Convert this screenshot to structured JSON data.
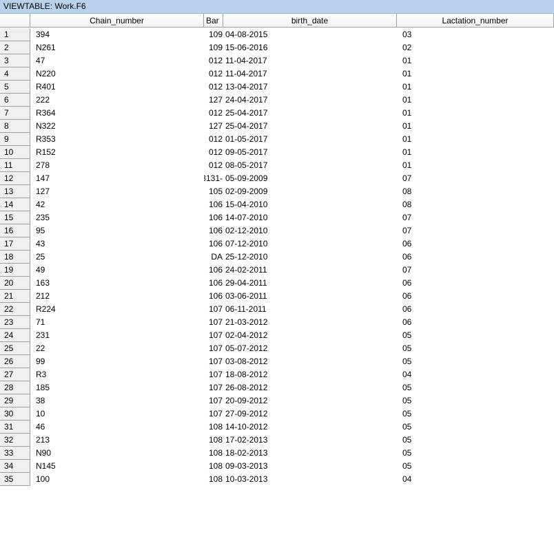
{
  "window": {
    "title": "VIEWTABLE: Work.F6"
  },
  "table": {
    "columns": [
      "Chain_number",
      "Bar",
      "birth_date",
      "Lactation_number"
    ],
    "rows": [
      [
        "1",
        "394",
        "109",
        "04-08-2015",
        "03"
      ],
      [
        "2",
        "N261",
        "109",
        "15-06-2016",
        "02"
      ],
      [
        "3",
        "47",
        "012",
        "11-04-2017",
        "01"
      ],
      [
        "4",
        "N220",
        "012",
        "11-04-2017",
        "01"
      ],
      [
        "5",
        "R401",
        "012",
        "13-04-2017",
        "01"
      ],
      [
        "6",
        "222",
        "127",
        "24-04-2017",
        "01"
      ],
      [
        "7",
        "R364",
        "012",
        "25-04-2017",
        "01"
      ],
      [
        "8",
        "N322",
        "127",
        "25-04-2017",
        "01"
      ],
      [
        "9",
        "R353",
        "012",
        "01-05-2017",
        "01"
      ],
      [
        "10",
        "R152",
        "012",
        "09-05-2017",
        "01"
      ],
      [
        "11",
        "278",
        "012",
        "08-05-2017",
        "01"
      ],
      [
        "12",
        "147",
        "3131-",
        "05-09-2009",
        "07"
      ],
      [
        "13",
        "127",
        "105",
        "02-09-2009",
        "08"
      ],
      [
        "14",
        "42",
        "106",
        "15-04-2010",
        "08"
      ],
      [
        "15",
        "235",
        "106",
        "14-07-2010",
        "07"
      ],
      [
        "16",
        "95",
        "106",
        "02-12-2010",
        "07"
      ],
      [
        "17",
        "43",
        "106",
        "07-12-2010",
        "06"
      ],
      [
        "18",
        "25",
        "DA",
        "25-12-2010",
        "06"
      ],
      [
        "19",
        "49",
        "106",
        "24-02-2011",
        "07"
      ],
      [
        "20",
        "163",
        "106",
        "29-04-2011",
        "06"
      ],
      [
        "21",
        "212",
        "106",
        "03-06-2011",
        "06"
      ],
      [
        "22",
        "R224",
        "107",
        "06-11-2011",
        "06"
      ],
      [
        "23",
        "71",
        "107",
        "21-03-2012",
        "06"
      ],
      [
        "24",
        "231",
        "107",
        "02-04-2012",
        "05"
      ],
      [
        "25",
        "22",
        "107",
        "05-07-2012",
        "05"
      ],
      [
        "26",
        "99",
        "107",
        "03-08-2012",
        "05"
      ],
      [
        "27",
        "R3",
        "107",
        "18-08-2012",
        "04"
      ],
      [
        "28",
        "185",
        "107",
        "26-08-2012",
        "05"
      ],
      [
        "29",
        "38",
        "107",
        "20-09-2012",
        "05"
      ],
      [
        "30",
        "10",
        "107",
        "27-09-2012",
        "05"
      ],
      [
        "31",
        "46",
        "108",
        "14-10-2012",
        "05"
      ],
      [
        "32",
        "213",
        "108",
        "17-02-2013",
        "05"
      ],
      [
        "33",
        "N90",
        "108",
        "18-02-2013",
        "05"
      ],
      [
        "34",
        "N145",
        "108",
        "09-03-2013",
        "05"
      ],
      [
        "35",
        "100",
        "108",
        "10-03-2013",
        "04"
      ]
    ]
  }
}
